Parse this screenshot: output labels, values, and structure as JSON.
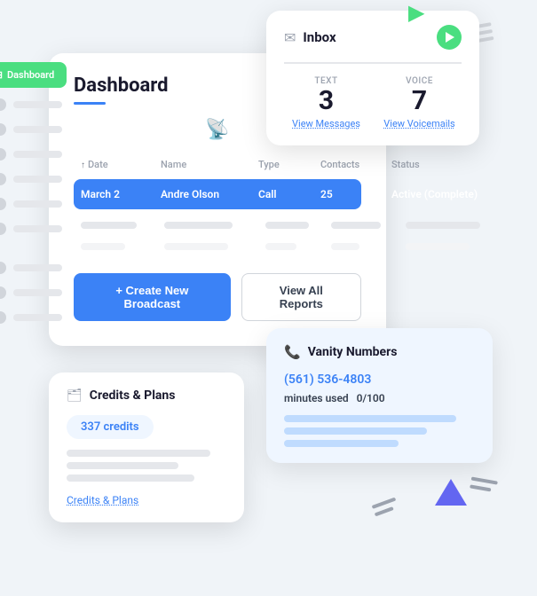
{
  "app": {
    "title": "Dashboard"
  },
  "sidebar": {
    "active_label": "Dashboard",
    "active_icon": "⊞"
  },
  "inbox_card": {
    "title": "Inbox",
    "text_label": "TEXT",
    "text_count": "3",
    "voice_label": "VOICE",
    "voice_count": "7",
    "view_messages_link": "View Messages",
    "view_voicemails_link": "View Voicemails"
  },
  "dashboard_card": {
    "title": "Dashboard",
    "table": {
      "headers": [
        "Date",
        "Name",
        "Type",
        "Contacts",
        "Status"
      ],
      "active_row": {
        "date": "March 2",
        "name": "Andre Olson",
        "type": "Call",
        "contacts": "25",
        "status": "Active (Complete)"
      }
    },
    "create_button": "+ Create New Broadcast",
    "view_button": "View All Reports"
  },
  "credits_card": {
    "title": "Credits & Plans",
    "credits_badge": "337 credits",
    "link_label": "Credits & Plans"
  },
  "vanity_card": {
    "title": "Vanity Numbers",
    "phone": "(561) 536-4803",
    "minutes_label": "minutes used",
    "minutes_value": "0/100"
  }
}
